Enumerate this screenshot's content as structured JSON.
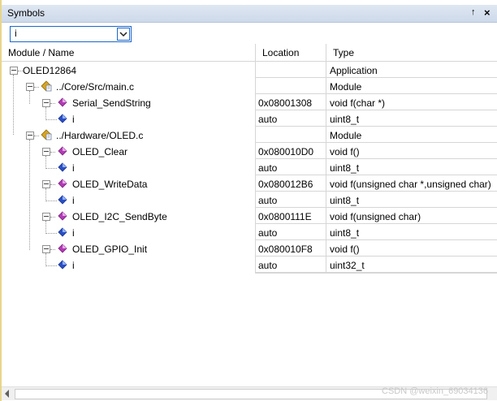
{
  "window": {
    "title": "Symbols",
    "pin_glyph": "↑",
    "close_glyph": "×"
  },
  "filter": {
    "value": "i"
  },
  "columns": {
    "name": "Module / Name",
    "location": "Location",
    "type": "Type"
  },
  "rows": [
    {
      "name": "OLED12864",
      "location": "",
      "type": "Application"
    },
    {
      "name": "../Core/Src/main.c",
      "location": "",
      "type": "Module"
    },
    {
      "name": "Serial_SendString",
      "location": "0x08001308",
      "type": "void f(char *)"
    },
    {
      "name": "i",
      "location": "auto",
      "type": "uint8_t"
    },
    {
      "name": "../Hardware/OLED.c",
      "location": "",
      "type": "Module"
    },
    {
      "name": "OLED_Clear",
      "location": "0x080010D0",
      "type": "void f()"
    },
    {
      "name": "i",
      "location": "auto",
      "type": "uint8_t"
    },
    {
      "name": "OLED_WriteData",
      "location": "0x080012B6",
      "type": "void f(unsigned char *,unsigned char)"
    },
    {
      "name": "i",
      "location": "auto",
      "type": "uint8_t"
    },
    {
      "name": "OLED_I2C_SendByte",
      "location": "0x0800111E",
      "type": "void f(unsigned char)"
    },
    {
      "name": "i",
      "location": "auto",
      "type": "uint8_t"
    },
    {
      "name": "OLED_GPIO_Init",
      "location": "0x080010F8",
      "type": "void f()"
    },
    {
      "name": "i",
      "location": "auto",
      "type": "uint32_t"
    }
  ],
  "icons": {
    "module": "module-file-icon",
    "function": "function-icon",
    "variable": "variable-icon"
  },
  "colors": {
    "function": "#b23bb5",
    "variable": "#2a4fc4",
    "module": "#d9a520",
    "titlebar": "#d6e0ee",
    "accent": "#1c67c9"
  },
  "watermark": "CSDN @weixin_69034136"
}
